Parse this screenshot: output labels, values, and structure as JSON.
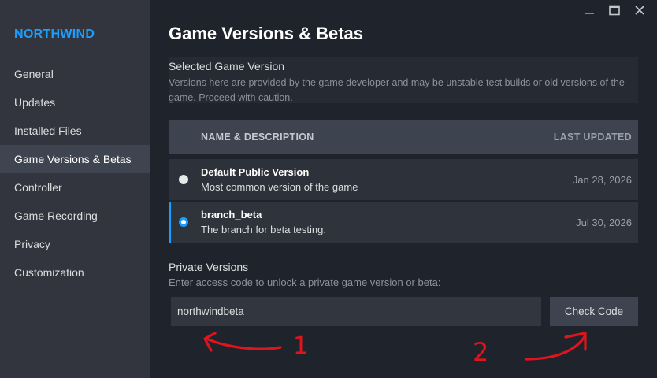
{
  "sidebar": {
    "brand": "NORTHWIND",
    "items": [
      {
        "label": "General"
      },
      {
        "label": "Updates"
      },
      {
        "label": "Installed Files"
      },
      {
        "label": "Game Versions & Betas"
      },
      {
        "label": "Controller"
      },
      {
        "label": "Game Recording"
      },
      {
        "label": "Privacy"
      },
      {
        "label": "Customization"
      }
    ],
    "active_index": 3
  },
  "window": {
    "controls": [
      "minimize-icon",
      "maximize-icon",
      "close-icon"
    ]
  },
  "page": {
    "title": "Game Versions & Betas"
  },
  "selected_version": {
    "title": "Selected Game Version",
    "description": "Versions here are provided by the game developer and may be unstable test builds or old versions of the game. Proceed with caution."
  },
  "versions_table": {
    "col_name": "NAME & DESCRIPTION",
    "col_updated": "LAST UPDATED",
    "rows": [
      {
        "name": "Default Public Version",
        "description": "Most common version of the game",
        "updated": "Jan 28, 2026",
        "selected": false
      },
      {
        "name": "branch_beta",
        "description": "The branch for beta testing.",
        "updated": "Jul 30, 2026",
        "selected": true
      }
    ]
  },
  "private_versions": {
    "title": "Private Versions",
    "description": "Enter access code to unlock a private game version or beta:",
    "input_value": "northwindbeta",
    "button_label": "Check Code"
  },
  "annotations": {
    "color": "#e0141e",
    "labels": [
      "1",
      "2"
    ]
  }
}
